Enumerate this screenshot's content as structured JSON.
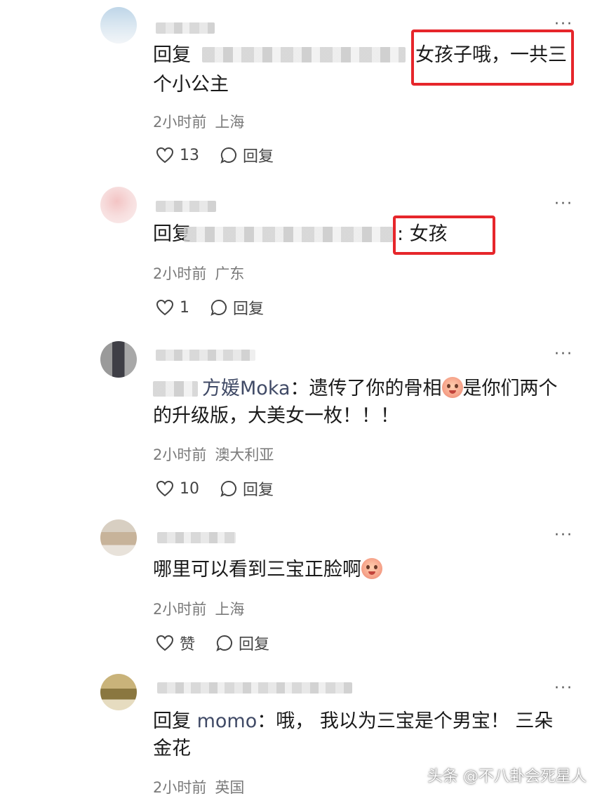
{
  "comments": [
    {
      "reply_prefix": "回复",
      "text": "女孩子哦，一共三个小公主",
      "text_line1": "女孩子哦，一共三",
      "text_line2": "个小公主",
      "time": "2小时前",
      "location": "上海",
      "likes": "13",
      "reply_label": "回复"
    },
    {
      "reply_prefix": "回复",
      "text": ": 女孩",
      "time": "2小时前",
      "location": "广东",
      "likes": "1",
      "reply_label": "回复"
    },
    {
      "mention": "方媛Moka",
      "separator": "：",
      "text_line1": "遗传了你的骨相",
      "text_line1b": "是你们两个",
      "text_line2": "的升级版，大美女一枚！！！",
      "time": "2小时前",
      "location": "澳大利亚",
      "likes": "10",
      "reply_label": "回复"
    },
    {
      "text": "哪里可以看到三宝正脸啊",
      "time": "2小时前",
      "location": "上海",
      "likes": "赞",
      "reply_label": "回复"
    },
    {
      "reply_prefix": "回复",
      "mention": "momo",
      "separator": "：",
      "text_line1": "哦，  我以为三宝是个男宝！  三朵",
      "text_line2": "金花",
      "time": "2小时前",
      "location": "英国"
    }
  ],
  "more_label": "···",
  "watermark": "头条 @不八卦会死星人",
  "colors": {
    "highlight": "#e6262b",
    "meta": "#7a7a7a",
    "mention": "#404a66"
  },
  "icons": [
    "heart-icon",
    "comment-bubble-icon",
    "more-icon",
    "emoji-icon"
  ]
}
